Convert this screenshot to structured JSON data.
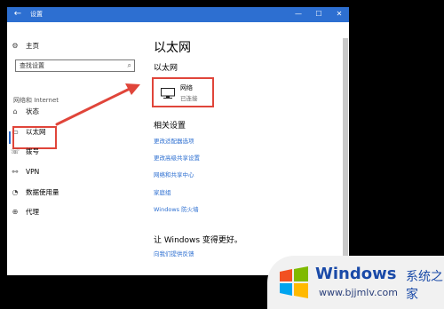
{
  "window": {
    "title": "设置",
    "back_icon": "back-arrow-icon"
  },
  "sidebar": {
    "home": "主页",
    "search_placeholder": "查找设置",
    "section": "网络和 Internet",
    "items": [
      {
        "label": "状态",
        "icon": "status-icon"
      },
      {
        "label": "以太网",
        "icon": "ethernet-icon",
        "selected": true
      },
      {
        "label": "拨号",
        "icon": "dialup-icon"
      },
      {
        "label": "VPN",
        "icon": "vpn-icon"
      },
      {
        "label": "数据使用量",
        "icon": "data-usage-icon"
      },
      {
        "label": "代理",
        "icon": "proxy-icon"
      }
    ]
  },
  "content": {
    "title": "以太网",
    "subtitle": "以太网",
    "network": {
      "name": "网络",
      "status": "已连接"
    },
    "related_heading": "相关设置",
    "links": [
      "更改适配器选项",
      "更改高级共享设置",
      "网络和共享中心",
      "家庭组",
      "Windows 防火墙"
    ],
    "windows_heading": "让 Windows 变得更好。",
    "feedback_link": "向我们提供反馈"
  },
  "watermark": {
    "brand": "Windows",
    "tagline": "系统之家",
    "url": "www.bjjmlv.com"
  },
  "colors": {
    "accent": "#2d6fd1",
    "highlight": "#e0453a",
    "titlebar": "#2d6fd1"
  }
}
